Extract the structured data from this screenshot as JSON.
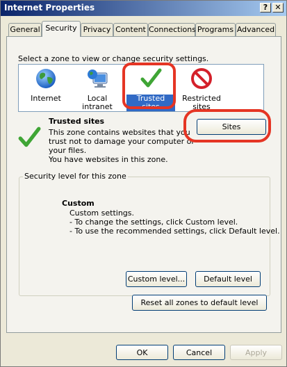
{
  "window": {
    "title": "Internet Properties",
    "help_button": "?",
    "close_button": "✕"
  },
  "tabs": [
    {
      "label": "General"
    },
    {
      "label": "Security"
    },
    {
      "label": "Privacy"
    },
    {
      "label": "Content"
    },
    {
      "label": "Connections"
    },
    {
      "label": "Programs"
    },
    {
      "label": "Advanced"
    }
  ],
  "security": {
    "zone_prompt": "Select a zone to view or change security settings.",
    "zones": [
      {
        "label": "Internet",
        "icon": "globe-icon"
      },
      {
        "label": "Local intranet",
        "icon": "computer-globe-icon"
      },
      {
        "label": "Trusted sites",
        "icon": "green-check-icon",
        "selected": true
      },
      {
        "label_line1": "Restricted",
        "label_line2": "sites",
        "icon": "no-entry-icon"
      }
    ],
    "selected_zone": {
      "title": "Trusted sites",
      "desc_lines": [
        "This zone contains websites that you",
        "trust not to damage your computer or",
        "your files.",
        "You have websites in this zone."
      ]
    },
    "sites_button": "Sites",
    "group_title": "Security level for this zone",
    "level": {
      "title": "Custom",
      "lines": [
        "Custom settings.",
        "- To change the settings, click Custom level.",
        "- To use the recommended settings, click Default level."
      ]
    },
    "custom_level_button": "Custom level...",
    "default_level_button": "Default level",
    "reset_button": "Reset all zones to default level"
  },
  "footer": {
    "ok": "OK",
    "cancel": "Cancel",
    "apply": "Apply"
  },
  "colors": {
    "title_bar": "#0a246a",
    "selection": "#316ac5",
    "annotation_red": "#e53524",
    "check_green": "#3fa535"
  }
}
